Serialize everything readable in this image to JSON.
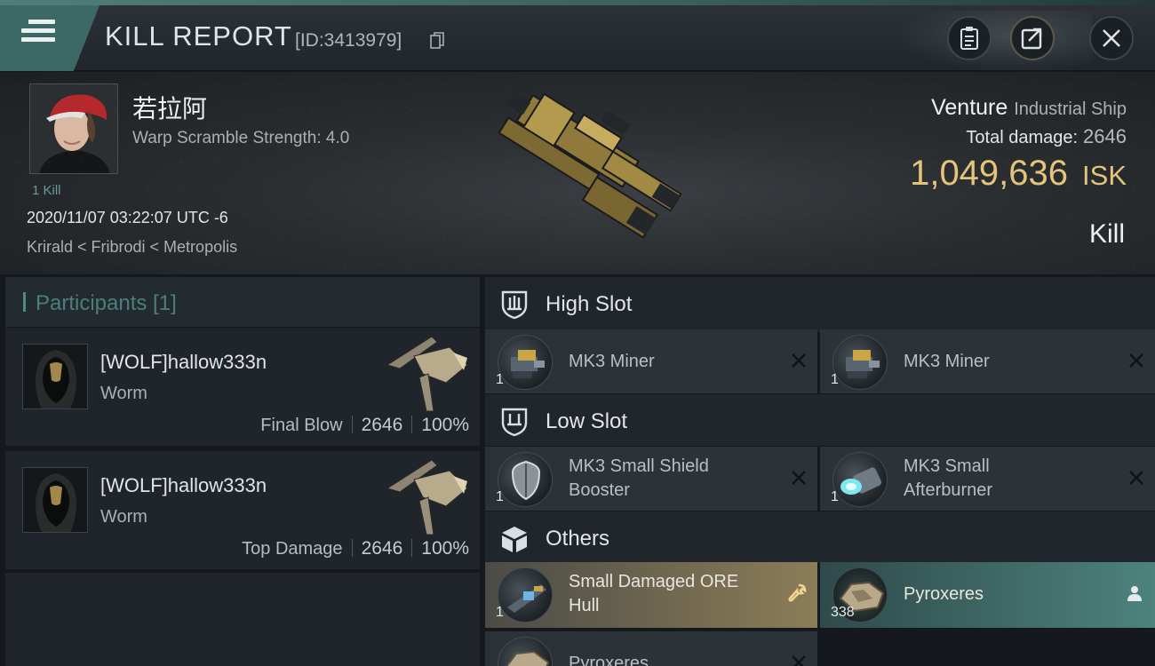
{
  "header": {
    "title": "KILL REPORT",
    "report_id": "[ID:3413979]",
    "icons": [
      "menu-icon",
      "copy-icon",
      "clipboard-icon",
      "share-icon",
      "close-icon"
    ]
  },
  "victim": {
    "name": "若拉阿",
    "warp_scramble": "Warp Scramble Strength: 4.0",
    "kills": "1 Kill",
    "datetime": "2020/11/07 03:22:07 UTC -6",
    "location": "Krirald < Fribrodi < Metropolis",
    "ship_name": "Venture",
    "ship_class": "Industrial Ship",
    "total_damage_label": "Total damage:",
    "total_damage": "2646",
    "isk_value": "1,049,636",
    "isk_unit": "ISK",
    "result": "Kill"
  },
  "participants": {
    "title": "Participants [1]",
    "items": [
      {
        "name": "[WOLF]hallow333n",
        "ship": "Worm",
        "role": "Final Blow",
        "damage": "2646",
        "percent": "100%"
      },
      {
        "name": "[WOLF]hallow333n",
        "ship": "Worm",
        "role": "Top Damage",
        "damage": "2646",
        "percent": "100%"
      }
    ]
  },
  "fittings": {
    "high": {
      "title": "High Slot",
      "items": [
        {
          "name": "MK3 Miner",
          "qty": "1"
        },
        {
          "name": "MK3 Miner",
          "qty": "1"
        }
      ]
    },
    "low": {
      "title": "Low Slot",
      "items": [
        {
          "name_l1": "MK3 Small Shield",
          "name_l2": "Booster",
          "qty": "1"
        },
        {
          "name_l1": "MK3 Small",
          "name_l2": "Afterburner",
          "qty": "1"
        }
      ]
    },
    "others": {
      "title": "Others",
      "items": [
        {
          "name_l1": "Small Damaged ORE",
          "name_l2": "Hull",
          "qty": "1",
          "status": "destroyed"
        },
        {
          "name": "Pyroxeres",
          "qty": "338",
          "status": "dropped"
        },
        {
          "name": "Pyroxeres",
          "qty": ""
        }
      ]
    }
  },
  "colors": {
    "accent": "#4f8a84",
    "isk": "#e4c37b",
    "destroyed_bg": "#8c7d58",
    "dropped_bg": "#4d837d"
  }
}
